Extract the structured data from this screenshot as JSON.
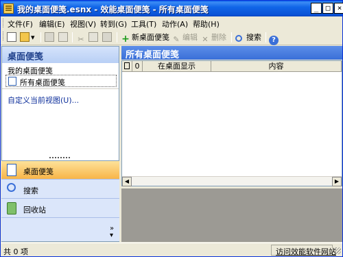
{
  "window": {
    "title": "我的桌面便笺.esnx - 效能桌面便笺 - 所有桌面便笺"
  },
  "menu": [
    {
      "label": "文件(F)"
    },
    {
      "label": "编辑(E)"
    },
    {
      "label": "视图(V)"
    },
    {
      "label": "转到(G)"
    },
    {
      "label": "工具(T)"
    },
    {
      "label": "动作(A)"
    },
    {
      "label": "帮助(H)"
    }
  ],
  "toolbar": {
    "new_note": "新桌面便笺",
    "edit": "编辑",
    "delete": "删除",
    "search": "搜索"
  },
  "left": {
    "header": "桌面便笺",
    "subtitle": "我的桌面便笺",
    "selected_folder": "所有桌面便笺",
    "customize_link": "自定义当前视图(U)..."
  },
  "nav": [
    {
      "label": "桌面便笺",
      "icon": "notes-icon"
    },
    {
      "label": "搜索",
      "icon": "search-icon"
    },
    {
      "label": "回收站",
      "icon": "recycle-bin-icon"
    }
  ],
  "right": {
    "header": "所有桌面便笺",
    "columns": [
      "在桌面显示",
      "内容"
    ]
  },
  "status": {
    "count_text": "共 0 项",
    "website_link": "访问效能软件网站"
  },
  "colors": {
    "titlebar": "#0a52d6",
    "pane_header": "#3a6fd8",
    "nav_active": "#f8b548"
  }
}
